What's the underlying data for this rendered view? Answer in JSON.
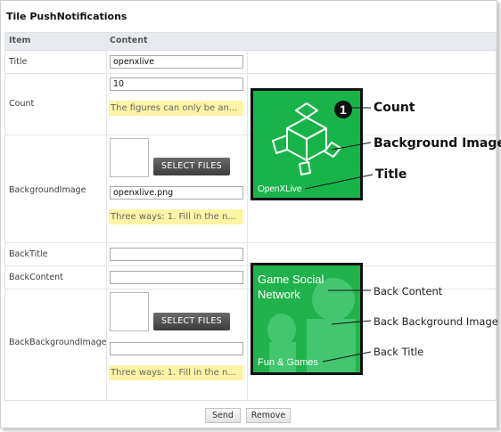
{
  "page": {
    "title": "Tile PushNotifications"
  },
  "table": {
    "col_item": "Item",
    "col_content": "Content"
  },
  "rows": {
    "title": {
      "label": "Title",
      "value": "openxlive"
    },
    "count": {
      "label": "Count",
      "value": "10",
      "note": "The figures can only be an..."
    },
    "background_image": {
      "label": "BackgroundImage",
      "select_label": "SELECT FILES",
      "value": "openxlive.png",
      "note": "Three ways: 1. Fill in the n..."
    },
    "back_title": {
      "label": "BackTitle",
      "value": ""
    },
    "back_content": {
      "label": "BackContent",
      "value": ""
    },
    "back_background_image": {
      "label": "BackBackgroundImage",
      "select_label": "SELECT FILES",
      "value": "",
      "note": "Three ways: 1. Fill in the n..."
    }
  },
  "front_tile": {
    "count_badge": "1",
    "tile_title": "OpenXLive",
    "annotations": {
      "count": "Count",
      "background": "Background Image",
      "title": "Title"
    }
  },
  "back_tile": {
    "content_text": "Game Social Network",
    "title_text": "Fun & Games",
    "annotations": {
      "content": "Back Content",
      "background": "Back Background Image",
      "title": "Back Title"
    }
  },
  "actions": {
    "send": "Send",
    "remove": "Remove"
  },
  "colors": {
    "tile_green": "#18b44a",
    "note_yellow": "#fff3a6",
    "header_bg": "#e7ebef"
  }
}
